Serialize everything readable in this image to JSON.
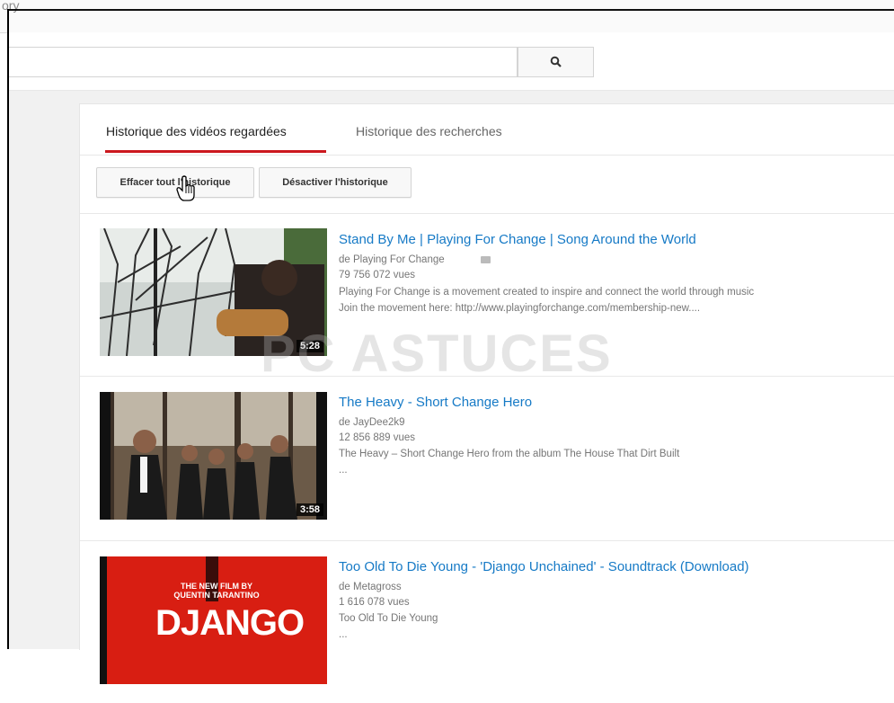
{
  "topbar": {
    "crumb": "ory"
  },
  "search": {
    "placeholder": ""
  },
  "tabs": [
    {
      "label": "Historique des vidéos regardées",
      "active": true
    },
    {
      "label": "Historique des recherches",
      "active": false
    }
  ],
  "actions": {
    "clear_label": "Effacer tout l'historique",
    "pause_label": "Désactiver l'historique"
  },
  "watermark": "PC ASTUCES",
  "videos": [
    {
      "title": "Stand By Me | Playing For Change | Song Around the World",
      "channel": "de Playing For Change",
      "views": "79 756 072 vues",
      "desc1": "Playing For Change is a movement created to inspire and connect the world through music",
      "desc2": "Join the movement here: http://www.playingforchange.com/membership-new....",
      "duration": "5:28"
    },
    {
      "title": "The Heavy - Short Change Hero",
      "channel": "de JayDee2k9",
      "views": "12 856 889 vues",
      "desc1": "The Heavy – Short Change Hero from the album The House That Dirt Built",
      "desc2": "...",
      "duration": "3:58"
    },
    {
      "title": "Too Old To Die Young - 'Django Unchained' - Soundtrack (Download)",
      "channel": "de Metagross",
      "views": "1 616 078 vues",
      "desc1": "Too Old To Die Young",
      "desc2": "...",
      "thumb_text": "DJANGO",
      "thumb_sub": "THE NEW FILM BY QUENTIN TARANTINO"
    }
  ],
  "colors": {
    "accent": "#cc181e",
    "link": "#167ac6"
  }
}
